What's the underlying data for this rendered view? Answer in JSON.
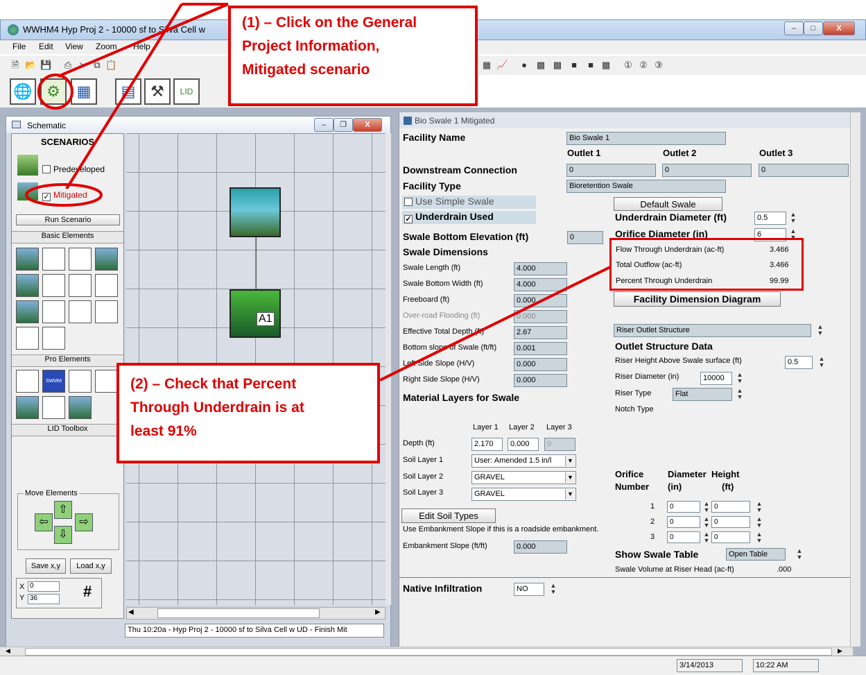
{
  "window": {
    "title": "WWHM4  Hyp Proj 2 - 10000 sf to Silva Cell w"
  },
  "menu": [
    "File",
    "Edit",
    "View",
    "Zoom",
    "Help"
  ],
  "schematic": {
    "title": "Schematic",
    "scenarios_header": "SCENARIOS",
    "predeveloped_label": "Predeveloped",
    "mitigated_label": "Mitigated",
    "run_scenario": "Run Scenario",
    "basic_elements": "Basic Elements",
    "pro_elements": "Pro Elements",
    "lid_toolbox": "LID Toolbox",
    "move_elements": "Move Elements",
    "save_xy": "Save x,y",
    "load_xy": "Load x,y",
    "x_label": "X",
    "x_value": "0",
    "y_label": "Y",
    "y_value": "36",
    "grid_icon": "#",
    "status_dropdown": "Thu 10:20a - Hyp Proj 2 - 10000 sf to Silva Cell w UD - Finish Mit",
    "node_label": "A1"
  },
  "facility": {
    "panel_title": "Bio Swale 1 Mitigated",
    "facility_name_label": "Facility Name",
    "facility_name": "Bio Swale 1",
    "outlet1": "Outlet 1",
    "outlet2": "Outlet 2",
    "outlet3": "Outlet 3",
    "downstream_label": "Downstream Connection",
    "downstream": [
      "0",
      "0",
      "0"
    ],
    "facility_type_label": "Facility Type",
    "facility_type": "Bioretention Swale",
    "use_simple_swale": "Use Simple Swale",
    "underdrain_used": "Underdrain Used",
    "default_swale": "Default Swale",
    "underdrain_diam_label": "Underdrain Diameter (ft)",
    "underdrain_diam": "0.5",
    "orifice_diam_label": "Orifice Diameter (in)",
    "orifice_diam": "6",
    "swale_bottom_elev_label": "Swale Bottom Elevation (ft)",
    "swale_bottom_elev": "0",
    "swale_dimensions": "Swale Dimensions",
    "dims": [
      {
        "label": "Swale Length (ft)",
        "value": "4.000"
      },
      {
        "label": "Swale Bottom Width (ft)",
        "value": "4.000"
      },
      {
        "label": "Freeboard (ft)",
        "value": "0.000"
      },
      {
        "label": "Over-road Flooding (ft)",
        "value": "0.000"
      },
      {
        "label": "Effective Total Depth (ft)",
        "value": "2.67"
      },
      {
        "label": "Bottom slope of Swale (ft/ft)",
        "value": "0.001"
      },
      {
        "label": "Left Side Slope (H/V)",
        "value": "0.000"
      },
      {
        "label": "Right Side Slope (H/V)",
        "value": "0.000"
      }
    ],
    "results": [
      {
        "label": "Flow Through Underdrain (ac-ft)",
        "value": "3.466"
      },
      {
        "label": "Total Outflow (ac-ft)",
        "value": "3.466"
      },
      {
        "label": "Percent Through Underdrain",
        "value": "99.99"
      }
    ],
    "facility_dim_diagram": "Facility Dimension Diagram",
    "riser_outlet": "Riser Outlet Structure",
    "outlet_structure_data": "Outlet Structure Data",
    "riser_height_label": "Riser Height Above Swale surface (ft)",
    "riser_height": "0.5",
    "riser_diam_label": "Riser Diameter (in)",
    "riser_diam": "10000",
    "riser_type_label": "Riser Type",
    "riser_type": "Flat",
    "notch_type_label": "Notch Type",
    "material_layers": "Material Layers for Swale",
    "layer_headers": [
      "Layer 1",
      "Layer 2",
      "Layer 3"
    ],
    "depth_label": "Depth (ft)",
    "depths": [
      "2.170",
      "0.000",
      "0"
    ],
    "soil_layers": [
      {
        "label": "Soil Layer 1",
        "value": "User: Amended 1.5 in/l"
      },
      {
        "label": "Soil Layer 2",
        "value": "GRAVEL"
      },
      {
        "label": "Soil Layer 3",
        "value": "GRAVEL"
      }
    ],
    "edit_soil_types": "Edit Soil Types",
    "embankment_note": "Use Embankment Slope if this is a roadside embankment.",
    "embankment_label": "Embankment Slope (ft/ft)",
    "embankment_value": "0.000",
    "orifice_hdr": "Orifice",
    "number_hdr": "Number",
    "diameter_hdr": "Diameter",
    "in_hdr": "(in)",
    "height_hdr": "Height",
    "ft_hdr": "(ft)",
    "orifices": [
      {
        "n": "1",
        "d": "0",
        "h": "0"
      },
      {
        "n": "2",
        "d": "0",
        "h": "0"
      },
      {
        "n": "3",
        "d": "0",
        "h": "0"
      }
    ],
    "show_swale_table": "Show Swale Table",
    "open_table": "Open Table",
    "swale_volume_label": "Swale Volume at Riser Head (ac-ft)",
    "swale_volume": ".000",
    "native_infiltration_label": "Native Infiltration",
    "native_infiltration": "NO"
  },
  "callouts": {
    "c1": [
      "(1) –  Click on the General",
      "Project Information,",
      "Mitigated scenario"
    ],
    "c2": [
      "(2) –  Check that Percent",
      "Through Underdrain is at",
      "least 91%"
    ]
  },
  "statusbar": {
    "date": "3/14/2013",
    "time": "10:22 AM"
  }
}
